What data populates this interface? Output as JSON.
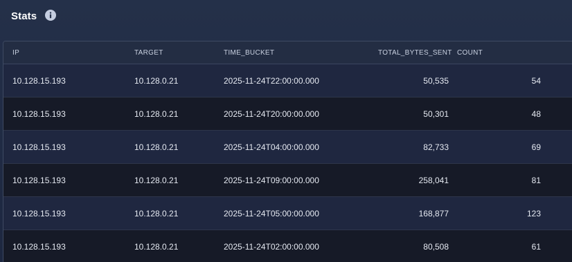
{
  "header": {
    "title": "Stats",
    "info_icon": "info-icon"
  },
  "table": {
    "columns": [
      "IP",
      "TARGET",
      "TIME_BUCKET",
      "TOTAL_BYTES_SENT",
      "COUNT"
    ],
    "rows": [
      [
        "10.128.15.193",
        "10.128.0.21",
        "2025-11-24T22:00:00.000",
        "50,535",
        "54"
      ],
      [
        "10.128.15.193",
        "10.128.0.21",
        "2025-11-24T20:00:00.000",
        "50,301",
        "48"
      ],
      [
        "10.128.15.193",
        "10.128.0.21",
        "2025-11-24T04:00:00.000",
        "82,733",
        "69"
      ],
      [
        "10.128.15.193",
        "10.128.0.21",
        "2025-11-24T09:00:00.000",
        "258,041",
        "81"
      ],
      [
        "10.128.15.193",
        "10.128.0.21",
        "2025-11-24T05:00:00.000",
        "168,877",
        "123"
      ],
      [
        "10.128.15.193",
        "10.128.0.21",
        "2025-11-24T02:00:00.000",
        "80,508",
        "61"
      ]
    ]
  },
  "colors": {
    "header_bg": "#243049",
    "row_odd": "#1f2740",
    "row_even": "#161a27",
    "text": "#e6eaf2",
    "header_text": "#c9d1e1"
  }
}
